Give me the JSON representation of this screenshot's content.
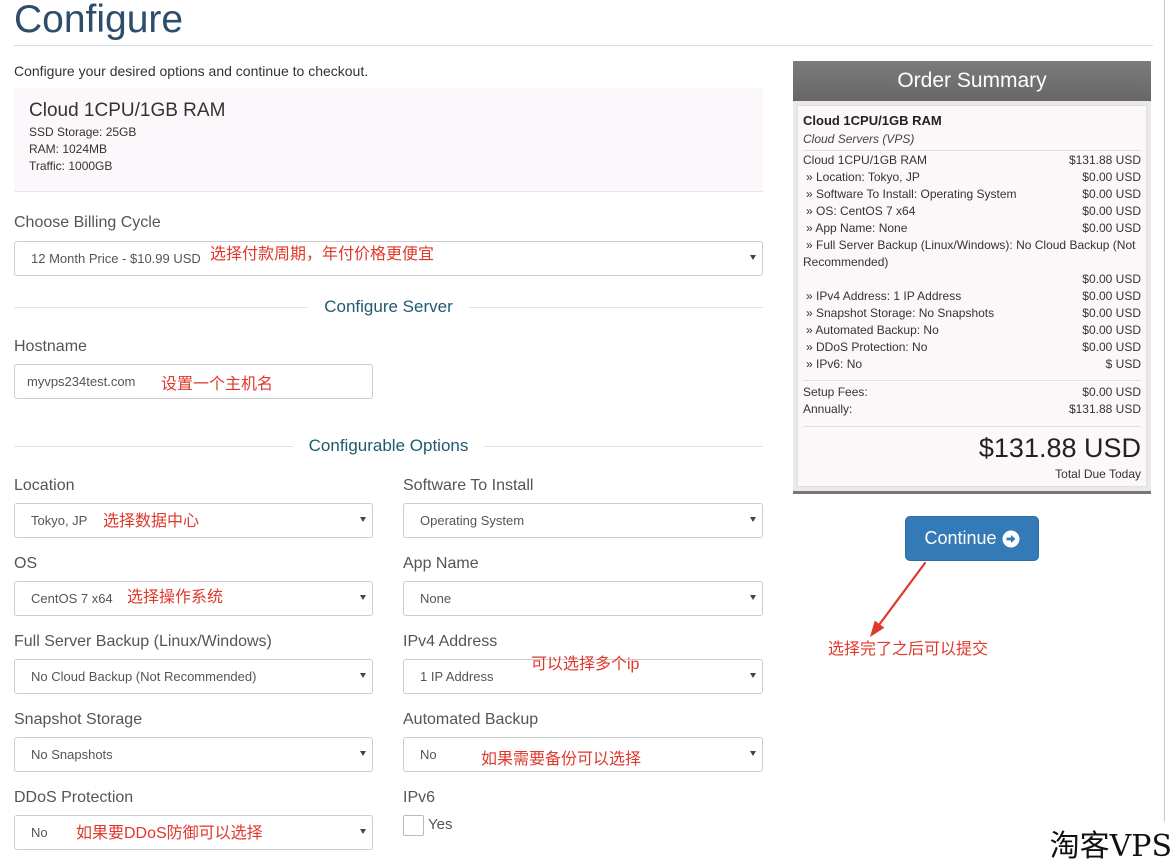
{
  "page": {
    "title": "Configure",
    "subtitle": "Configure your desired options and continue to checkout."
  },
  "product": {
    "name": "Cloud 1CPU/1GB RAM",
    "specs": [
      "SSD Storage: 25GB",
      "RAM: 1024MB",
      "Traffic: 1000GB"
    ]
  },
  "billing": {
    "label": "Choose Billing Cycle",
    "selected": "12 Month Price - $10.99 USD"
  },
  "configure_server": {
    "heading": "Configure Server",
    "hostname_label": "Hostname",
    "hostname_value": "myvps234test.com"
  },
  "configurable_options": {
    "heading": "Configurable Options",
    "options": [
      {
        "label": "Location",
        "value": "Tokyo, JP"
      },
      {
        "label": "Software To Install",
        "value": "Operating System"
      },
      {
        "label": "OS",
        "value": "CentOS 7 x64"
      },
      {
        "label": "App Name",
        "value": "None"
      },
      {
        "label": "Full Server Backup (Linux/Windows)",
        "value": "No Cloud Backup (Not Recommended)"
      },
      {
        "label": "IPv4 Address",
        "value": "1 IP Address"
      },
      {
        "label": "Snapshot Storage",
        "value": "No Snapshots"
      },
      {
        "label": "Automated Backup",
        "value": "No"
      },
      {
        "label": "DDoS Protection",
        "value": "No"
      }
    ],
    "ipv6": {
      "label": "IPv6",
      "checkbox_label": "Yes",
      "checked": false
    }
  },
  "order_summary": {
    "heading": "Order Summary",
    "product_name": "Cloud 1CPU/1GB RAM",
    "product_group": "Cloud Servers (VPS)",
    "items": [
      {
        "label": "Cloud 1CPU/1GB RAM",
        "price": "$131.88 USD"
      },
      {
        "label": "» Location: Tokyo, JP",
        "price": "$0.00 USD"
      },
      {
        "label": "» Software To Install: Operating System",
        "price": "$0.00 USD"
      },
      {
        "label": "» OS: CentOS 7 x64",
        "price": "$0.00 USD"
      },
      {
        "label": "» App Name: None",
        "price": "$0.00 USD"
      },
      {
        "label": "» Full Server Backup (Linux/Windows): No Cloud Backup (Not Recommended)",
        "price": "$0.00 USD"
      },
      {
        "label": "» IPv4 Address: 1 IP Address",
        "price": "$0.00 USD"
      },
      {
        "label": "» Snapshot Storage: No Snapshots",
        "price": "$0.00 USD"
      },
      {
        "label": "» Automated Backup: No",
        "price": "$0.00 USD"
      },
      {
        "label": "» DDoS Protection: No",
        "price": "$0.00 USD"
      },
      {
        "label": "» IPv6: No",
        "price": "$ USD"
      }
    ],
    "setup_fees_label": "Setup Fees:",
    "setup_fees": "$0.00 USD",
    "recurring_label": "Annually:",
    "recurring": "$131.88 USD",
    "total": "$131.88 USD",
    "total_label": "Total Due Today"
  },
  "continue_button": {
    "label": "Continue"
  },
  "annotations": {
    "billing_cycle": "选择付款周期，年付价格更便宜",
    "hostname": "设置一个主机名",
    "location": "选择数据中心",
    "os": "选择操作系统",
    "ipv4": "可以选择多个ip",
    "automated_backup": "如果需要备份可以选择",
    "ddos": "如果要DDoS防御可以选择",
    "continue": "选择完了之后可以提交"
  },
  "watermark": "淘客VPS",
  "icons": {
    "select_caret": "caret-down-icon",
    "continue": "arrow-circle-right-icon",
    "annotation_pointer": "red-arrow-icon"
  },
  "colors": {
    "accent": "#337ab7",
    "title": "#2e4d6b",
    "section_heading": "#205a70",
    "annotation": "#e0382c",
    "summary_header": "#6e6e6e"
  }
}
